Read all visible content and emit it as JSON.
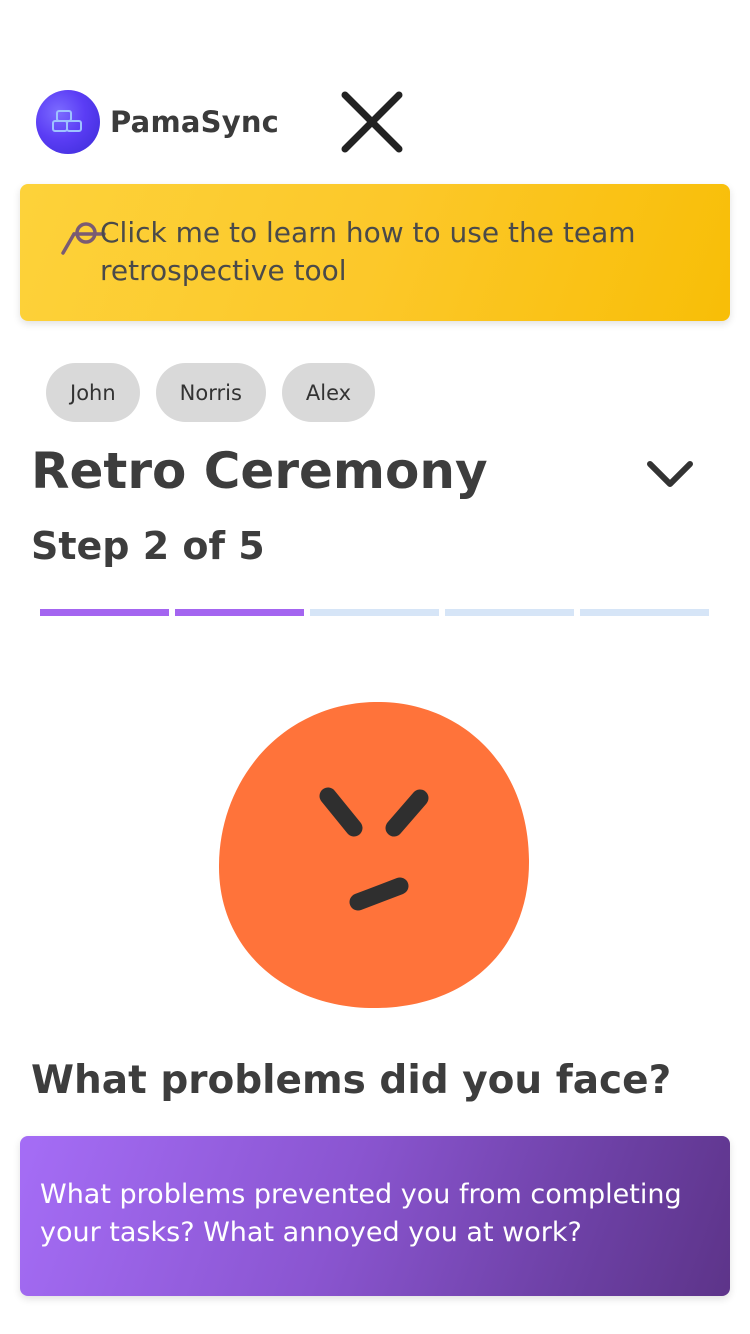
{
  "header": {
    "app_name": "PamaSync",
    "logo_icon": "stacked-blocks-icon",
    "close_icon": "close-icon"
  },
  "banner": {
    "text": "Click me to learn how to use the team retrospective tool",
    "icon": "magnifier-icon",
    "color": "#fcc82a"
  },
  "participants": [
    "John",
    "Norris",
    "Alex"
  ],
  "ceremony": {
    "title": "Retro Ceremony",
    "step_label": "Step 2 of 5",
    "current_step": 2,
    "total_steps": 5,
    "accent": "#a465f0"
  },
  "mood": {
    "icon": "angry-face-icon",
    "color": "#ff733a"
  },
  "question": {
    "title": "What problems did you face?",
    "prompt": "What problems prevented you from completing your tasks? What annoyed you at work?"
  }
}
